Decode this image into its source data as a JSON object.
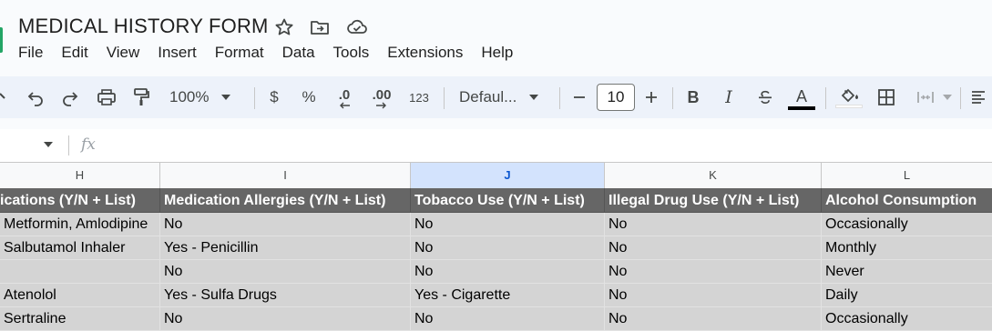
{
  "document": {
    "title": "MEDICAL HISTORY FORM"
  },
  "menu": [
    "File",
    "Edit",
    "View",
    "Insert",
    "Format",
    "Data",
    "Tools",
    "Extensions",
    "Help"
  ],
  "toolbar": {
    "zoom": "100%",
    "currency": "$",
    "percent": "%",
    "decrease_decimal": ".0",
    "increase_decimal": ".00",
    "number_format": "123",
    "font": "Defaul...",
    "font_size": "10",
    "bold": "B",
    "italic": "I",
    "text_color_letter": "A",
    "text_color": "#000000"
  },
  "formula_bar": {
    "fx": "fx"
  },
  "columns": [
    "H",
    "I",
    "J",
    "K",
    "L"
  ],
  "selected_column": "J",
  "sheet": {
    "headers": [
      "ications (Y/N + List)",
      "Medication Allergies (Y/N + List)",
      "Tobacco Use (Y/N + List)",
      "Illegal Drug Use (Y/N + List)",
      "Alcohol Consumption"
    ],
    "rows": [
      [
        "Metformin, Amlodipine",
        "No",
        "No",
        "No",
        "Occasionally"
      ],
      [
        "Salbutamol Inhaler",
        "Yes - Penicillin",
        "No",
        "No",
        "Monthly"
      ],
      [
        "",
        "No",
        "No",
        "No",
        "Never"
      ],
      [
        "Atenolol",
        "Yes - Sulfa Drugs",
        "Yes - Cigarette",
        "No",
        "Daily"
      ],
      [
        "Sertraline",
        "No",
        "No",
        "No",
        "Occasionally"
      ]
    ]
  },
  "colors": {
    "header_fill": "#666666",
    "body_fill": "#d4d4d4",
    "selected_column_header": "#d3e3fd",
    "toolbar_bg": "#edf2fa"
  }
}
